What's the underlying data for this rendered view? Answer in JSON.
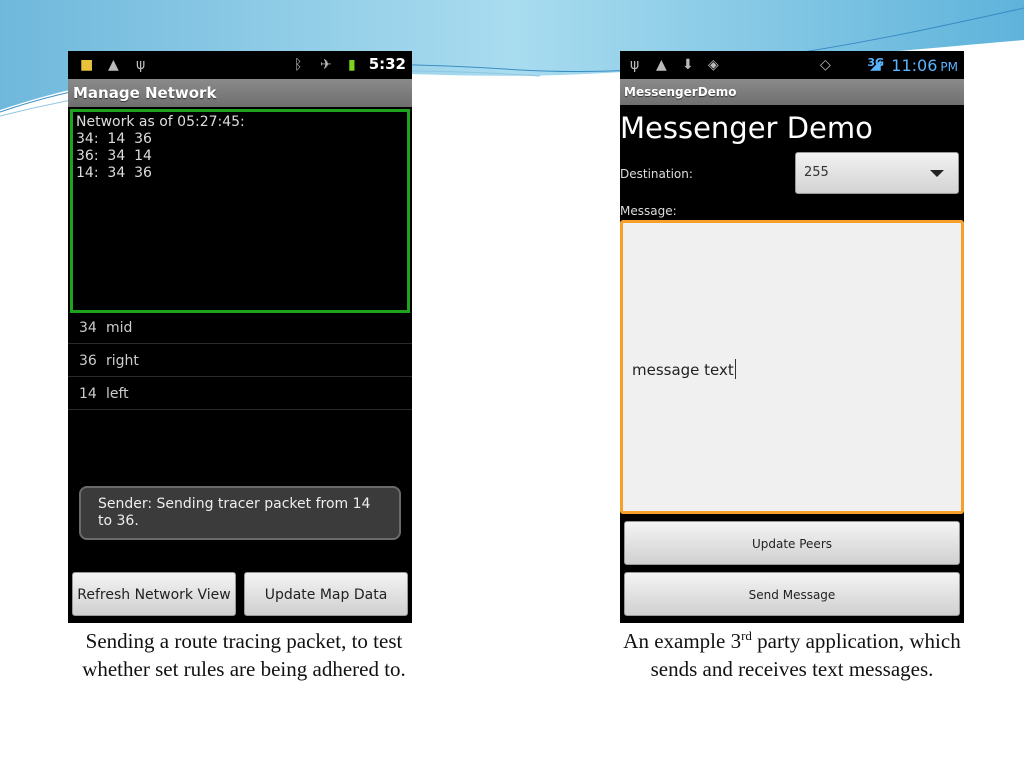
{
  "left_phone": {
    "status": {
      "time": "5:32"
    },
    "title": "Manage Network",
    "network_lines": [
      "Network as of 05:27:45:",
      "34:  14  36",
      "36:  34  14",
      "14:  34  36"
    ],
    "list": [
      {
        "num": "34",
        "label": "mid"
      },
      {
        "num": "36",
        "label": "right"
      },
      {
        "num": "14",
        "label": "left"
      }
    ],
    "toast": "Sender: Sending tracer packet from 14 to 36.",
    "buttons": {
      "refresh": "Refresh Network View",
      "update_map": "Update Map Data"
    }
  },
  "right_phone": {
    "status": {
      "network": "3G",
      "time": "11:06",
      "time_suffix": "PM"
    },
    "title": "MessengerDemo",
    "heading": "Messenger Demo",
    "destination_label": "Destination:",
    "destination_value": "255",
    "message_label": "Message:",
    "message_value": "message text",
    "buttons": {
      "update_peers": "Update Peers",
      "send": "Send Message"
    }
  },
  "captions": {
    "left": "Sending a route tracing packet, to test whether set rules are being adhered to.",
    "right_pre": "An example 3",
    "right_sup": "rd",
    "right_post": " party application, which sends and receives text messages."
  },
  "colors": {
    "network_box_border": "#1fa31f",
    "message_box_border": "#f5a02a",
    "status_time_right": "#5ab4ff"
  }
}
